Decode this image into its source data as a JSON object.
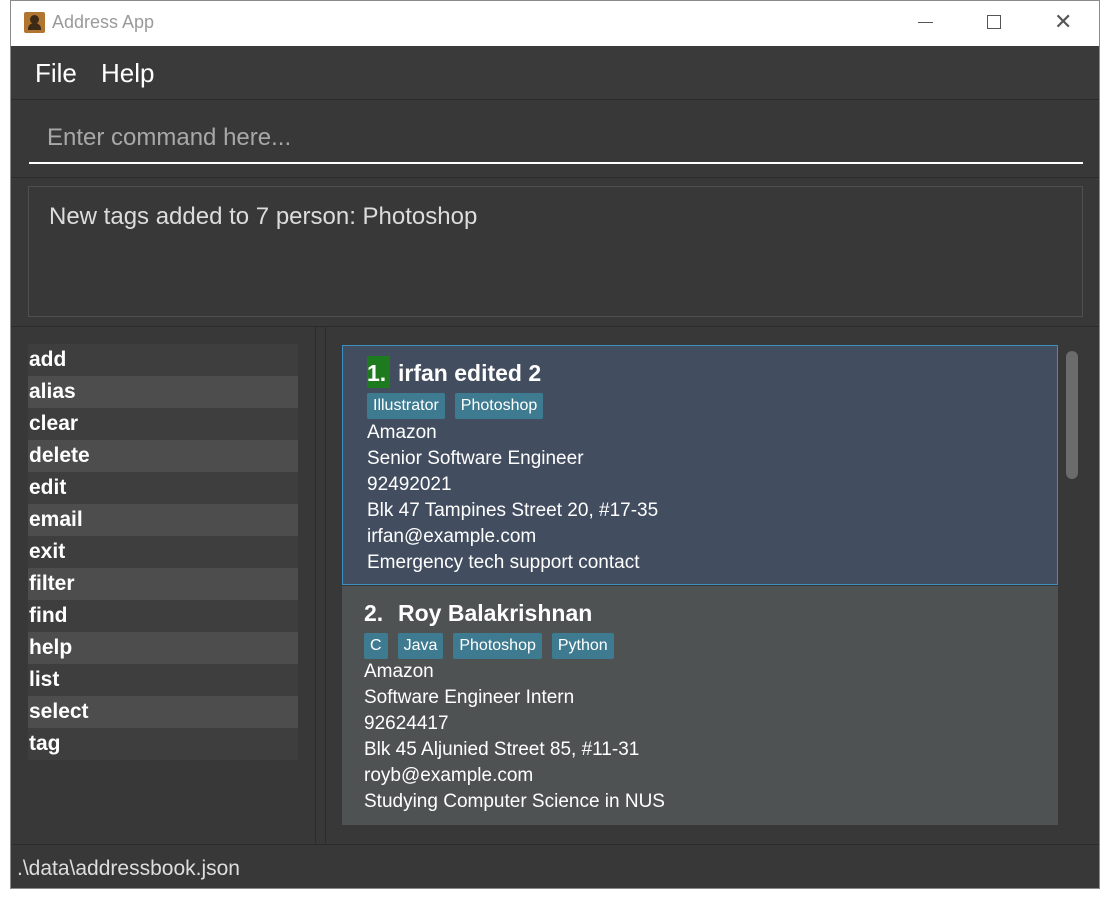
{
  "window": {
    "title": "Address App"
  },
  "menu": {
    "items": [
      "File",
      "Help"
    ]
  },
  "command": {
    "placeholder": "Enter command here...",
    "value": ""
  },
  "result": {
    "message": "New tags added to 7 person: Photoshop"
  },
  "commands": [
    "add",
    "alias",
    "clear",
    "delete",
    "edit",
    "email",
    "exit",
    "filter",
    "find",
    "help",
    "list",
    "select",
    "tag"
  ],
  "persons": [
    {
      "index": "1.",
      "name": "irfan edited 2",
      "tags": [
        "Illustrator",
        "Photoshop"
      ],
      "company": "Amazon",
      "role": "Senior Software Engineer",
      "phone": "92492021",
      "address": "Blk 47 Tampines Street 20, #17-35",
      "email": "irfan@example.com",
      "remark": "Emergency tech support contact"
    },
    {
      "index": "2.",
      "name": "Roy Balakrishnan",
      "tags": [
        "C",
        "Java",
        "Photoshop",
        "Python"
      ],
      "company": "Amazon",
      "role": "Software Engineer Intern",
      "phone": "92624417",
      "address": "Blk 45 Aljunied Street 85, #11-31",
      "email": "royb@example.com",
      "remark": "Studying Computer Science in NUS"
    }
  ],
  "status": {
    "path": ".\\data\\addressbook.json"
  },
  "colors": {
    "background": "#383838",
    "selected_card": "#424d5f",
    "card": "#4f5253",
    "tag": "#3e7b91",
    "index_highlight": "#1e7a1e"
  }
}
